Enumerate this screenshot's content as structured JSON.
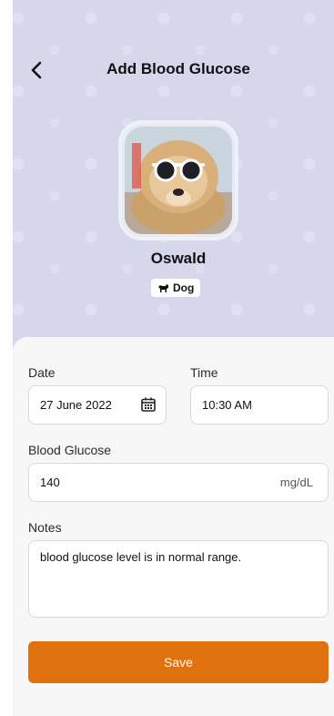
{
  "header": {
    "title": "Add Blood Glucose"
  },
  "pet": {
    "name": "Oswald",
    "species": "Dog"
  },
  "form": {
    "date": {
      "label": "Date",
      "value": "27 June 2022"
    },
    "time": {
      "label": "Time",
      "value": "10:30 AM"
    },
    "glucose": {
      "label": "Blood Glucose",
      "value": "140",
      "unit": "mg/dL"
    },
    "notes": {
      "label": "Notes",
      "value": "blood glucose level is in normal range."
    }
  },
  "actions": {
    "save_label": "Save"
  },
  "colors": {
    "header_bg": "#d6d7eb",
    "accent": "#e1710f",
    "card_bg": "#f7f7f8"
  },
  "icons": {
    "back": "chevron-left-icon",
    "calendar": "calendar-icon",
    "species": "dog-icon"
  }
}
